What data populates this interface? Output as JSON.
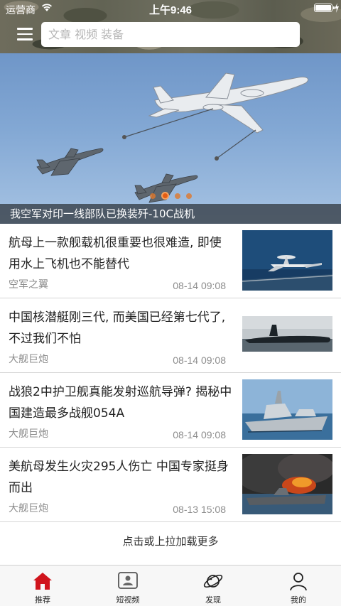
{
  "status_bar": {
    "carrier": "运营商",
    "time": "上午9:46"
  },
  "search": {
    "placeholder": "文章 视频 装备"
  },
  "banner": {
    "caption": "我空军对印一线部队已换装歼-10C战机",
    "dot_count": 4,
    "active_dot": 1
  },
  "news": [
    {
      "title": "航母上一款舰载机很重要也很难造, 即使用水上飞机也不能替代",
      "source": "空军之翼",
      "time": "08-14 09:08",
      "thumb": "carrier-aircraft"
    },
    {
      "title": "中国核潜艇刚三代, 而美国已经第七代了, 不过我们不怕",
      "source": "大舰巨炮",
      "time": "08-14 09:08",
      "thumb": "submarine"
    },
    {
      "title": "战狼2中护卫舰真能发射巡航导弹? 揭秘中国建造最多战舰054A",
      "source": "大舰巨炮",
      "time": "08-14 09:08",
      "thumb": "frigate"
    },
    {
      "title": "美航母发生火灾295人伤亡 中国专家挺身而出",
      "source": "大舰巨炮",
      "time": "08-13 15:08",
      "thumb": "carrier-fire"
    }
  ],
  "load_more": "点击或上拉加载更多",
  "tabs": [
    {
      "label": "推荐",
      "icon": "home-icon",
      "active": true
    },
    {
      "label": "短视频",
      "icon": "video-icon",
      "active": false
    },
    {
      "label": "发现",
      "icon": "planet-icon",
      "active": false
    },
    {
      "label": "我的",
      "icon": "user-icon",
      "active": false
    }
  ],
  "colors": {
    "accent": "#d0141c",
    "dot": "#e35d14"
  }
}
